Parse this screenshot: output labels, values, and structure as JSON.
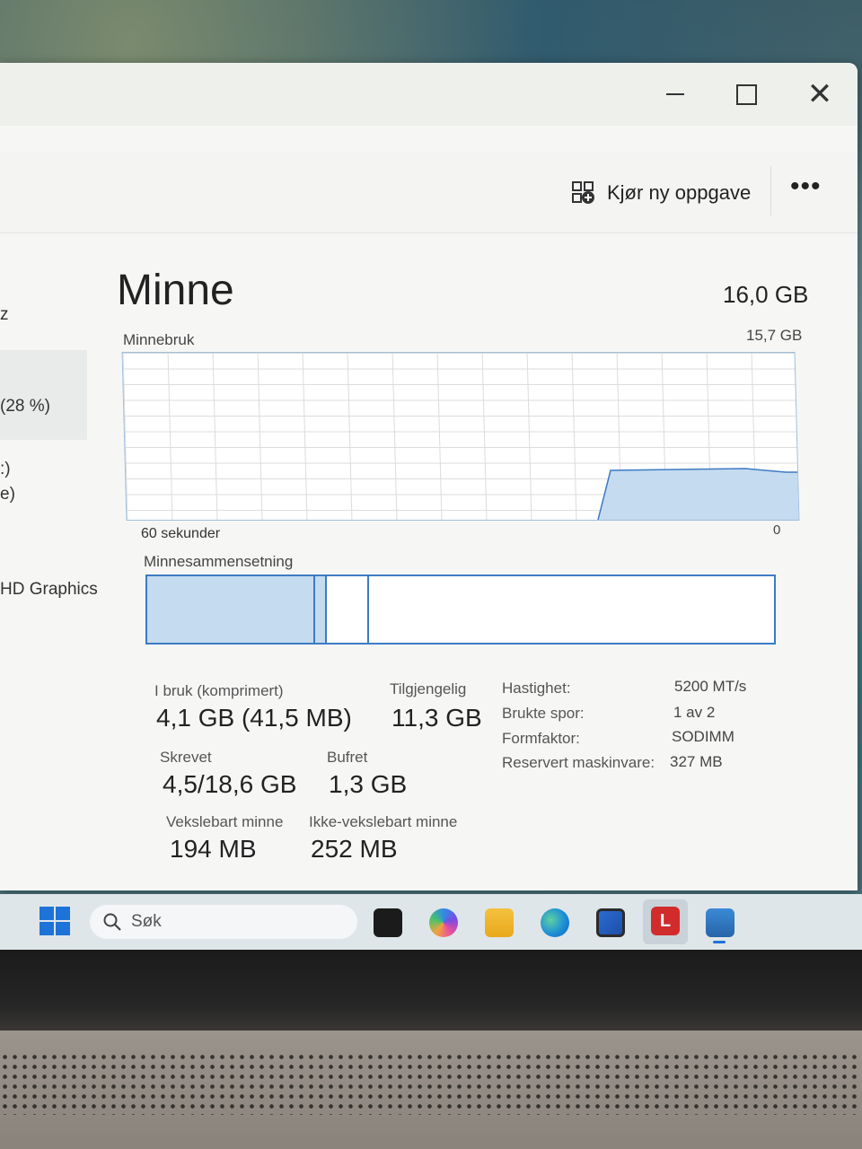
{
  "window": {
    "controls": {
      "minimize": "—",
      "maximize": "☐",
      "close": "✕"
    },
    "toolbar": {
      "run_new_task": "Kjør ny oppgave",
      "more": "•••"
    }
  },
  "sidebar": {
    "items": [
      {
        "text": "z"
      },
      {
        "text": "(28 %)"
      },
      {
        "text": ":)"
      },
      {
        "text": "e)"
      },
      {
        "text": "HD Graphics"
      }
    ]
  },
  "memory": {
    "title": "Minne",
    "total": "16,0 GB",
    "graph": {
      "label": "Minnebruk",
      "max": "15,7 GB",
      "x_left": "60 sekunder",
      "x_right": "0"
    },
    "composition_label": "Minnesammensetning",
    "composition": {
      "in_use_fraction": 0.27,
      "modified_fraction": 0.02,
      "standby_fraction": 0.065
    },
    "stats": {
      "in_use_label": "I bruk (komprimert)",
      "in_use_value": "4,1 GB (41,5 MB)",
      "available_label": "Tilgjengelig",
      "available_value": "11,3 GB",
      "committed_label": "Skrevet",
      "committed_value": "4,5/18,6 GB",
      "cached_label": "Bufret",
      "cached_value": "1,3 GB",
      "paged_label": "Vekslebart minne",
      "paged_value": "194 MB",
      "nonpaged_label": "Ikke-vekslebart minne",
      "nonpaged_value": "252 MB"
    },
    "details": [
      {
        "label": "Hastighet:",
        "value": "5200 MT/s"
      },
      {
        "label": "Brukte spor:",
        "value": "1 av 2"
      },
      {
        "label": "Formfaktor:",
        "value": "SODIMM"
      },
      {
        "label": "Reservert maskinvare:",
        "value": "327 MB"
      }
    ]
  },
  "taskbar": {
    "search_placeholder": "Søk",
    "active_app_letter": "L"
  },
  "colors": {
    "accent": "#3d7bc4",
    "graph_fill": "#c5dbef",
    "taskbar": "#dfe6ea"
  }
}
